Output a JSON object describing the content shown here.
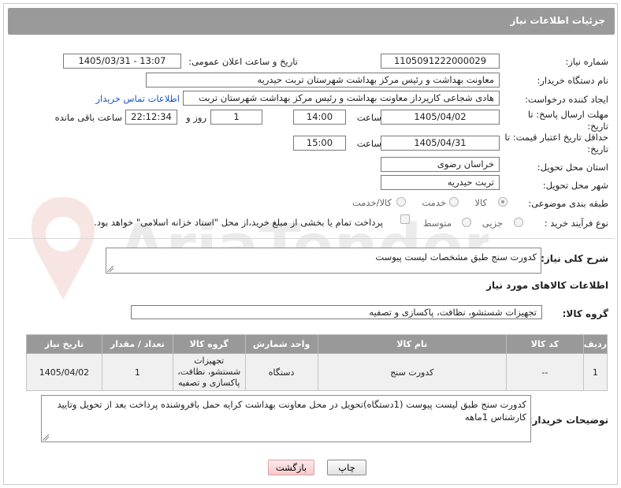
{
  "header": {
    "title": "جزئیات اطلاعات نیاز"
  },
  "labels": {
    "need_number": "شماره نیاز:",
    "announce_datetime": "تاریخ و ساعت اعلان عمومی:",
    "buyer_org": "نام دستگاه خریدار:",
    "requester": "ایجاد کننده درخواست:",
    "reply_deadline": "مهلت ارسال پاسخ: تا تاریخ:",
    "price_validity": "حداقل تاریخ اعتبار قیمت: تا تاریخ:",
    "time": "ساعت",
    "day_and": "روز و",
    "remaining": "ساعت باقی مانده",
    "province": "استان محل تحویل:",
    "city": "شهر محل تحویل:",
    "category": "طبقه بندی موضوعی:",
    "process_type": "نوع فرآیند خرید :",
    "general_desc": "شرح کلی نیاز:",
    "goods_info": "اطلاعات کالاهای مورد نیاز",
    "goods_group": "گروه کالا:",
    "buyer_notes": "توضیحات خریدار:"
  },
  "fields": {
    "need_number": "1105091222000029",
    "announce_datetime": "1405/03/31 - 13:07",
    "buyer_org": "معاونت بهداشت و رئیس مرکز بهداشت شهرستان تربت حیدریه",
    "requester": "هادی شجاعی کارپرداز معاونت بهداشت و رئیس مرکز بهداشت شهرستان تربت",
    "contact_link": "اطلاعات تماس خریدار",
    "reply_date": "1405/04/02",
    "reply_time": "14:00",
    "days_left": "1",
    "time_left": "22:12:34",
    "validity_date": "1405/04/31",
    "validity_time": "15:00",
    "province": "خراسان رضوی",
    "city": "تربت حیدریه",
    "general_desc": "کدورت سنج طبق مشخصات لیست پیوست",
    "goods_group": "تجهیزات شستشو، نظافت، پاکسازی و تصفیه",
    "buyer_notes": "کدورت سنج طبق لیست پیوست (1دستگاه)تحویل در محل معاونت بهداشت کرایه حمل بافروشنده پرداخت بعد از تحویل وتایید کارشناس 1ماهه"
  },
  "category_options": [
    {
      "label": "کالا",
      "checked": true
    },
    {
      "label": "خدمت",
      "checked": false
    },
    {
      "label": "کالا/خدمت",
      "checked": false
    }
  ],
  "process_options": [
    {
      "label": "جزیی",
      "checked": false
    },
    {
      "label": "متوسط",
      "checked": false
    }
  ],
  "payment_note": "پرداخت تمام یا بخشی از مبلغ خرید،از محل \"اسناد خزانه اسلامی\" خواهد بود.",
  "watermark": "AriaTender.net",
  "table": {
    "headers": [
      "ردیف",
      "کد کالا",
      "نام کالا",
      "واحد شمارش",
      "گروه کالا",
      "تعداد / مقدار",
      "تاریخ نیاز"
    ],
    "rows": [
      [
        "1",
        "--",
        "کدورت سنج",
        "دستگاه",
        "تجهیزات شستشو، نظافت، پاکسازی و تصفیه",
        "1",
        "1405/04/02"
      ]
    ]
  },
  "buttons": {
    "print": "چاپ",
    "back": "بازگشت"
  },
  "colors": {
    "header_bg": "#9a9a9a",
    "link": "#1a56c4",
    "back_button": "#f5c9cc"
  }
}
